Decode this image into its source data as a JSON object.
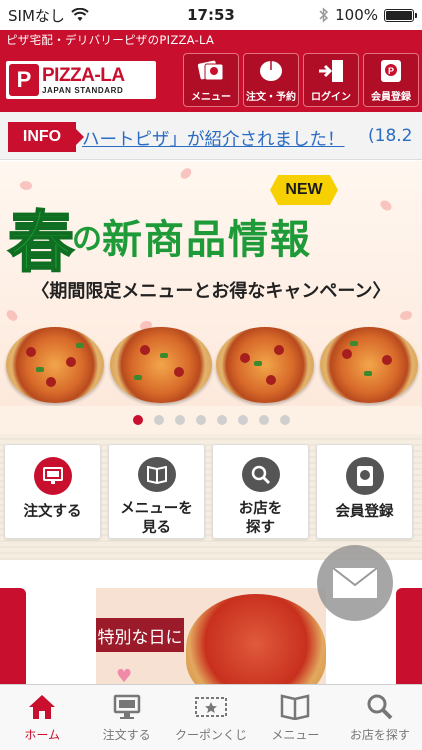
{
  "status": {
    "carrier": "SIMなし",
    "time": "17:53",
    "battery": "100%",
    "battery_level": 1.0
  },
  "header": {
    "subtitle": "ピザ宅配・デリバリーピザのPIZZA-LA",
    "logo": {
      "mark": "P",
      "name": "PIZZA-LA",
      "tagline": "JAPAN STANDARD"
    },
    "buttons": [
      {
        "label": "メニュー",
        "icon": "menu-card-icon"
      },
      {
        "label": "注文・予約",
        "icon": "mouse-icon"
      },
      {
        "label": "ログイン",
        "icon": "login-door-icon"
      },
      {
        "label": "会員登録",
        "icon": "member-card-icon"
      }
    ]
  },
  "info": {
    "label": "INFO",
    "text": "ハートピザ」が紹介されました！",
    "date": "(18.2"
  },
  "banner": {
    "badge": "NEW",
    "title_char": "春",
    "title_no": "の",
    "title_rest": "新商品情報",
    "subtitle": "〈期間限定メニューとお得なキャンペーン〉",
    "slides_total": 8,
    "active_slide": 1
  },
  "tiles": [
    {
      "label": "注文する",
      "icon": "monitor-icon"
    },
    {
      "label": "メニューを\n見る",
      "icon": "book-icon"
    },
    {
      "label": "お店を\n探す",
      "icon": "search-icon"
    },
    {
      "label": "会員登録",
      "icon": "member-card-icon"
    }
  ],
  "promo": {
    "text": "特別な日に"
  },
  "tabbar": [
    {
      "label": "ホーム",
      "icon": "home-icon",
      "active": true
    },
    {
      "label": "注文する",
      "icon": "monitor-icon",
      "active": false
    },
    {
      "label": "クーポンくじ",
      "icon": "coupon-icon",
      "active": false
    },
    {
      "label": "メニュー",
      "icon": "book-icon",
      "active": false
    },
    {
      "label": "お店を探す",
      "icon": "search-icon",
      "active": false
    }
  ],
  "colors": {
    "brand_red": "#c8102e",
    "link_blue": "#2a6cc4",
    "banner_green": "#1e9b38",
    "badge_yellow": "#f6d000"
  }
}
